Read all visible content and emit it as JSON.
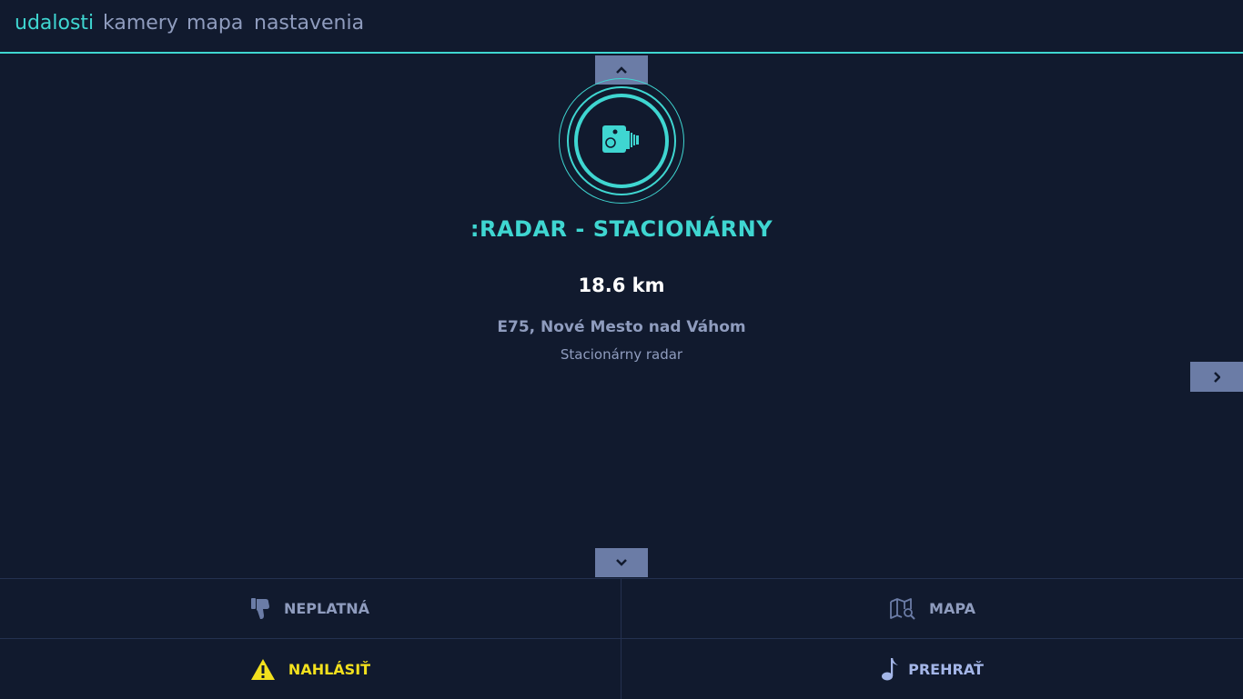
{
  "nav": {
    "tabs": [
      {
        "label": "udalosti",
        "active": true
      },
      {
        "label": "kamery",
        "active": false
      },
      {
        "label": "mapa",
        "active": false
      },
      {
        "label": "nastavenia",
        "active": false
      }
    ]
  },
  "event": {
    "icon": "speed-camera-icon",
    "title": ":RADAR - STACIONÁRNY",
    "distance": "18.6 km",
    "location": "E75, Nové Mesto nad Váhom",
    "description": "Stacionárny radar"
  },
  "actions": {
    "invalid": {
      "label": "NEPLATNÁ",
      "icon": "thumbs-down-icon"
    },
    "map": {
      "label": "MAPA",
      "icon": "map-search-icon"
    },
    "report": {
      "label": "NAHLÁSIŤ",
      "icon": "warning-icon"
    },
    "play": {
      "label": "PREHRAŤ",
      "icon": "music-note-icon"
    }
  },
  "colors": {
    "background": "#111a2e",
    "accent": "#3fd6d1",
    "muted": "#8f9cbe",
    "button": "#6b7ca6",
    "warning": "#f2e01e"
  }
}
